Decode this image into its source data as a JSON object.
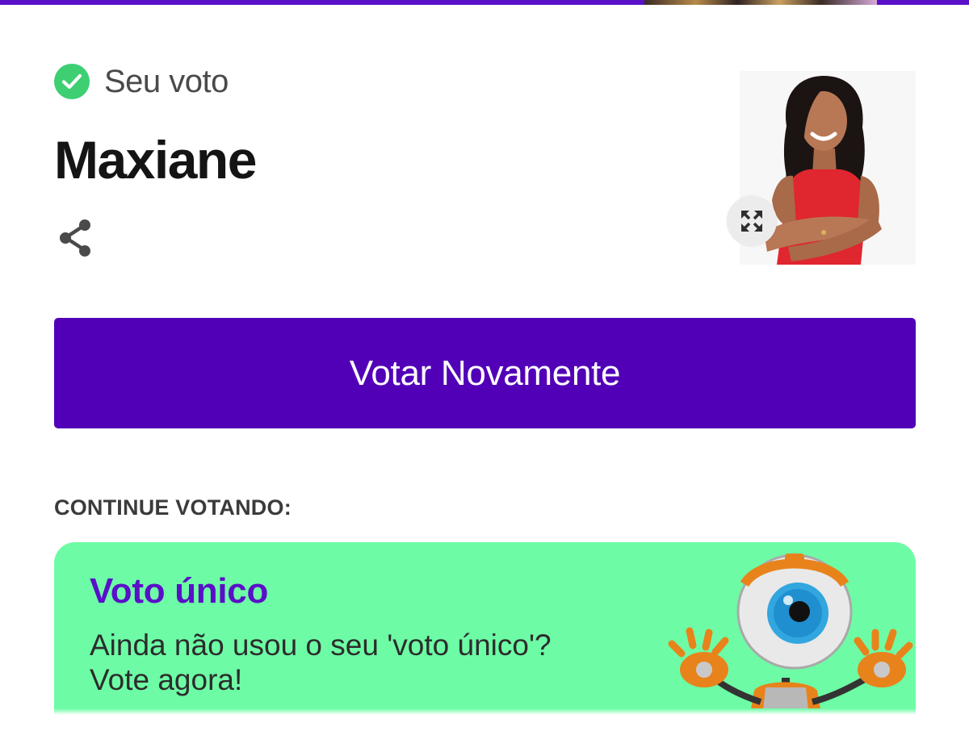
{
  "header": {
    "status_label": "Seu voto",
    "candidate_name": "Maxiane"
  },
  "actions": {
    "vote_again_label": "Votar Novamente"
  },
  "section": {
    "continue_label": "CONTINUE VOTANDO:"
  },
  "promo": {
    "title": "Voto único",
    "line1": "Ainda não usou o seu 'voto único'?",
    "line2": "Vote agora!"
  },
  "icons": {
    "status": "check-circle-icon",
    "share": "share-icon",
    "expand": "expand-icon"
  },
  "colors": {
    "brand_purple": "#5200b8",
    "success_green": "#3dcf72",
    "promo_background": "#6dfca5",
    "promo_title": "#5a0fc8"
  }
}
